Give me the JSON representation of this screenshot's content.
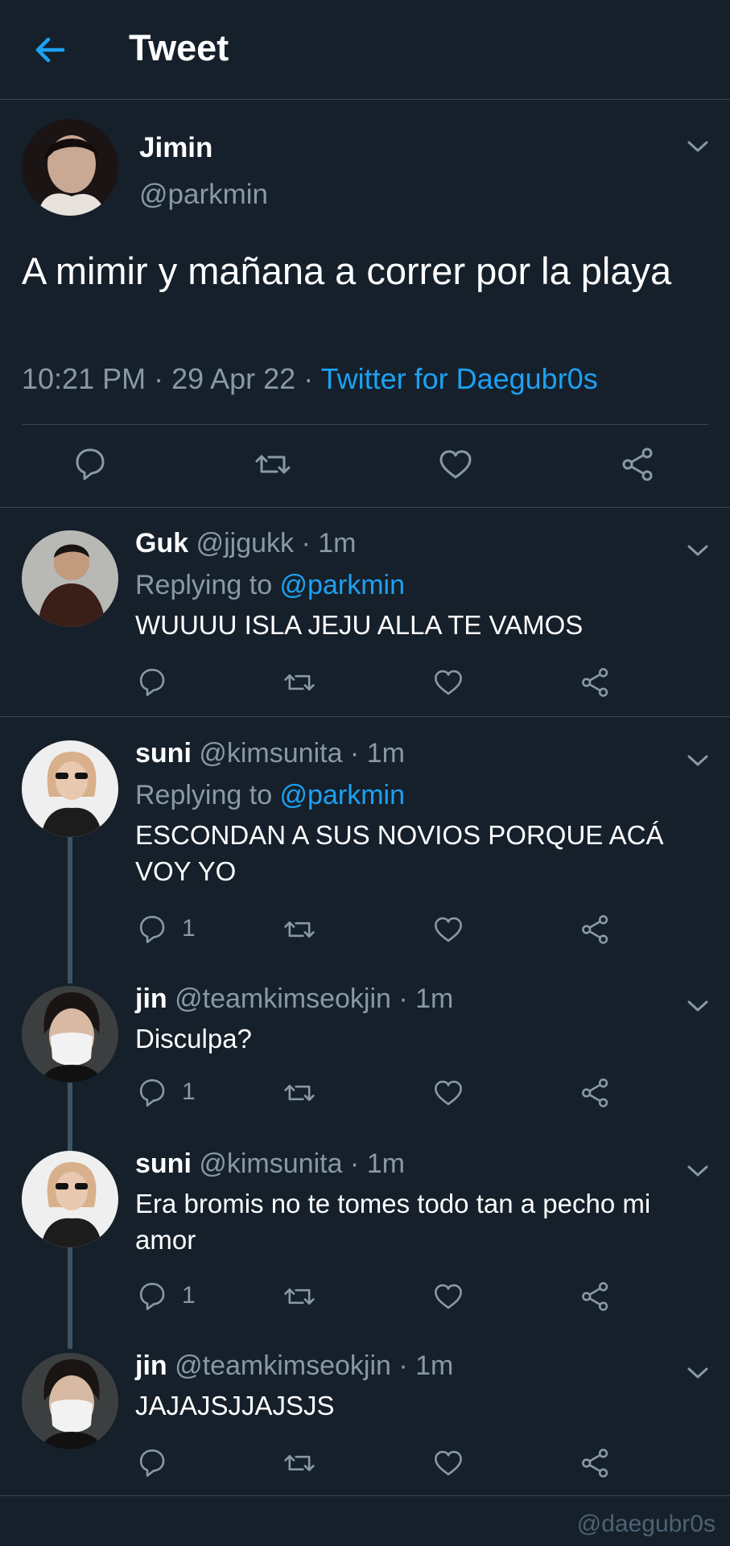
{
  "header": {
    "title": "Tweet",
    "back_icon": "arrow-left-icon",
    "accent": "#1da1f2"
  },
  "main_tweet": {
    "name": "Jimin",
    "handle": "@parkmin",
    "text": "A mimir y mañana a correr por la playa",
    "time": "10:21 PM · 29 Apr 22 · ",
    "source": "Twitter for Daegubr0s"
  },
  "replies": [
    {
      "name": "Guk",
      "handle": "@jjgukk · 1m",
      "replying_label": "Replying to ",
      "replying_to": "@parkmin",
      "text": "WUUUU ISLA JEJU ALLA TE VAMOS",
      "reply_count": ""
    },
    {
      "name": "suni",
      "handle": "@kimsunita · 1m",
      "replying_label": "Replying to ",
      "replying_to": "@parkmin",
      "text": "ESCONDAN A SUS NOVIOS PORQUE ACÁ VOY YO",
      "reply_count": "1"
    },
    {
      "name": "jin",
      "handle": "@teamkimseokjin · 1m",
      "text": "Disculpa?",
      "reply_count": "1"
    },
    {
      "name": "suni",
      "handle": "@kimsunita · 1m",
      "text": "Era bromis no te tomes todo tan a pecho mi amor",
      "reply_count": "1"
    },
    {
      "name": "jin",
      "handle": "@teamkimseokjin · 1m",
      "text": "JAJAJSJJAJSJS",
      "reply_count": ""
    }
  ],
  "watermark": "@daegubr0s",
  "colors": {
    "background": "#15202b",
    "secondary_text": "#8899a6",
    "divider": "#38444d",
    "link": "#1da1f2"
  }
}
